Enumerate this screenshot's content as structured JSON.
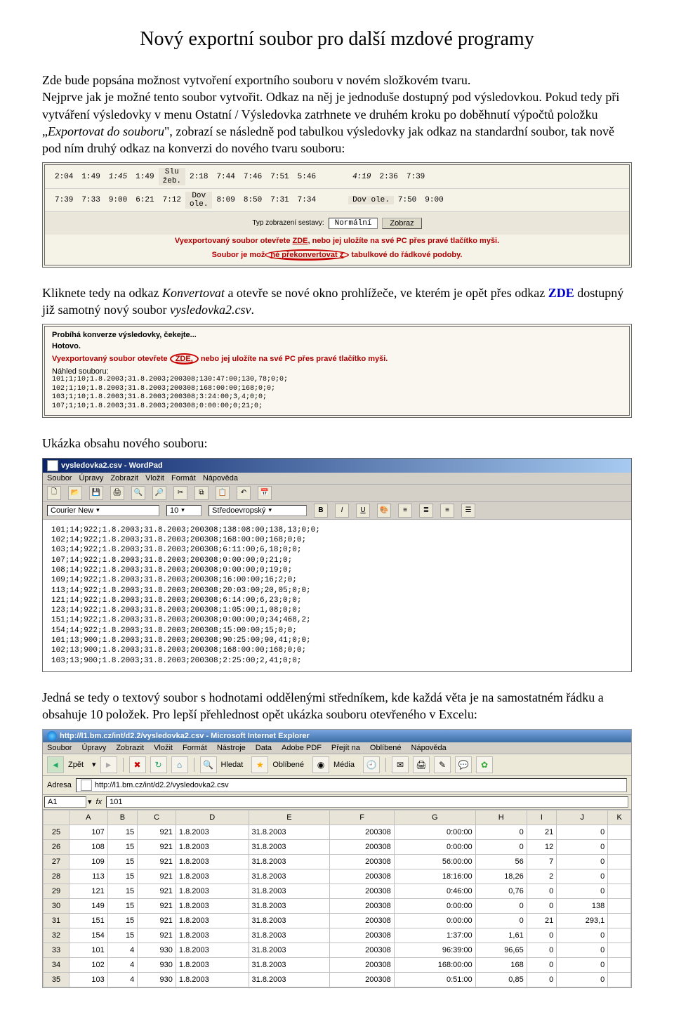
{
  "title": "Nový exportní soubor pro další mzdové programy",
  "intro": {
    "p1a": "Zde bude popsána možnost vytvoření exportního souboru v novém složkovém tvaru.",
    "p1b": "Nejprve jak je možné tento soubor vytvořit. Odkaz na něj je jednoduše dostupný pod výsledovkou. Pokud tedy při vytváření výsledovky v menu Ostatní / Výsledovka zatrhnete ve druhém kroku po doběhnutí výpočtů položku „",
    "p1c_italic": "Exportovat do souboru",
    "p1d": "\", zobrazí se následně pod tabulkou výsledovky jak odkaz na standardní soubor, tak nově pod ním druhý odkaz na konverzi do nového tvaru souboru:"
  },
  "panel1": {
    "row1": [
      "2:04",
      "1:49",
      "1:45",
      "1:49",
      "Slu\nžeb.",
      "2:18",
      "7:44",
      "7:46",
      "7:51",
      "5:46",
      "4:19",
      "2:36",
      "7:39"
    ],
    "row2": [
      "7:39",
      "7:33",
      "9:00",
      "6:21",
      "7:12",
      "Dov\nole.",
      "8:09",
      "8:50",
      "7:31",
      "7:34",
      "Dov\nole.",
      "7:50",
      "9:00"
    ],
    "display_label": "Typ zobrazení sestavy:",
    "display_value": "Normální",
    "display_btn": "Zobraz",
    "red1a": "Vyexportovaný soubor otevřete ",
    "red1_link": "ZDE",
    "red1b": ", nebo jej uložíte na své PC přes pravé tlačítko myši.",
    "red2a": "Soubor je mož",
    "red2_circle": "né překonvertovat z",
    "red2b": " tabulkové do řádkové podoby."
  },
  "mid": {
    "p2a": "Kliknete tedy na odkaz ",
    "p2b_italic": "Konvertovat",
    "p2c": "  a otevře se nové okno prohlížeče, ve kterém je opět přes odkaz ",
    "p2_zde": "ZDE",
    "p2d": " dostupný již samotný nový soubor ",
    "p2e_italic": "vysledovka2.csv",
    "p2f": "."
  },
  "panel2": {
    "line1": "Probíhá konverze výsledovky, čekejte...",
    "line2": "Hotovo.",
    "red_a": "Vyexportovaný soubor otevřete ",
    "red_link": "ZDE,",
    "red_b": " nebo jej uložíte na své PC přes pravé tlačítko myši.",
    "preview_label": "Náhled souboru:",
    "preview_lines": "101;1;10;1.8.2003;31.8.2003;200308;130:47:00;130,78;0;0;\n102;1;10;1.8.2003;31.8.2003;200308;168:00:00;168;0;0;\n103;1;10;1.8.2003;31.8.2003;200308;3:24:00;3,4;0;0;\n107;1;10;1.8.2003;31.8.2003;200308;0:00:00;0;21;0;"
  },
  "sample_label": "Ukázka obsahu nového souboru:",
  "wordpad": {
    "title": "vysledovka2.csv - WordPad",
    "menu": [
      "Soubor",
      "Úpravy",
      "Zobrazit",
      "Vložit",
      "Formát",
      "Nápověda"
    ],
    "font_name": "Courier New",
    "font_size": "10",
    "script": "Středoevropský",
    "body": "101;14;922;1.8.2003;31.8.2003;200308;138:08:00;138,13;0;0;\n102;14;922;1.8.2003;31.8.2003;200308;168:00:00;168;0;0;\n103;14;922;1.8.2003;31.8.2003;200308;6:11:00;6,18;0;0;\n107;14;922;1.8.2003;31.8.2003;200308;0:00:00;0;21;0;\n108;14;922;1.8.2003;31.8.2003;200308;0:00:00;0;19;0;\n109;14;922;1.8.2003;31.8.2003;200308;16:00:00;16;2;0;\n113;14;922;1.8.2003;31.8.2003;200308;20:03:00;20,05;0;0;\n121;14;922;1.8.2003;31.8.2003;200308;6:14:00;6,23;0;0;\n123;14;922;1.8.2003;31.8.2003;200308;1:05:00;1,08;0;0;\n151;14;922;1.8.2003;31.8.2003;200308;0:00:00;0;34;468,2;\n154;14;922;1.8.2003;31.8.2003;200308;15:00:00;15;0;0;\n101;13;900;1.8.2003;31.8.2003;200308;90:25:00;90,41;0;0;\n102;13;900;1.8.2003;31.8.2003;200308;168:00:00;168;0;0;\n103;13;900;1.8.2003;31.8.2003;200308;2:25:00;2,41;0;0;"
  },
  "para3a": "Jedná se tedy o textový soubor s hodnotami oddělenými středníkem, kde každá věta je na samostatném řádku a obsahuje 10 položek. Pro lepší přehlednost opět ukázka souboru otevřeného v Excelu:",
  "excel": {
    "title": "http://l1.bm.cz/int/d2.2/vysledovka2.csv - Microsoft Internet Explorer",
    "menu": [
      "Soubor",
      "Úpravy",
      "Zobrazit",
      "Vložit",
      "Formát",
      "Nástroje",
      "Data",
      "Adobe PDF",
      "Přejít na",
      "Oblíbené",
      "Nápověda"
    ],
    "back": "Zpět",
    "search": "Hledat",
    "fav": "Oblíbené",
    "media": "Média",
    "addr_label": "Adresa",
    "url": "http://l1.bm.cz/int/d2.2/vysledovka2.csv",
    "cell_name": "A1",
    "cell_value": "101",
    "cols": [
      "",
      "A",
      "B",
      "C",
      "D",
      "E",
      "F",
      "G",
      "H",
      "I",
      "J",
      "K"
    ],
    "rows": [
      {
        "n": "25",
        "c": [
          "107",
          "15",
          "921",
          "1.8.2003",
          "31.8.2003",
          "200308",
          "0:00:00",
          "0",
          "21",
          "0",
          ""
        ]
      },
      {
        "n": "26",
        "c": [
          "108",
          "15",
          "921",
          "1.8.2003",
          "31.8.2003",
          "200308",
          "0:00:00",
          "0",
          "12",
          "0",
          ""
        ]
      },
      {
        "n": "27",
        "c": [
          "109",
          "15",
          "921",
          "1.8.2003",
          "31.8.2003",
          "200308",
          "56:00:00",
          "56",
          "7",
          "0",
          ""
        ]
      },
      {
        "n": "28",
        "c": [
          "113",
          "15",
          "921",
          "1.8.2003",
          "31.8.2003",
          "200308",
          "18:16:00",
          "18,26",
          "2",
          "0",
          ""
        ]
      },
      {
        "n": "29",
        "c": [
          "121",
          "15",
          "921",
          "1.8.2003",
          "31.8.2003",
          "200308",
          "0:46:00",
          "0,76",
          "0",
          "0",
          ""
        ]
      },
      {
        "n": "30",
        "c": [
          "149",
          "15",
          "921",
          "1.8.2003",
          "31.8.2003",
          "200308",
          "0:00:00",
          "0",
          "0",
          "138",
          ""
        ]
      },
      {
        "n": "31",
        "c": [
          "151",
          "15",
          "921",
          "1.8.2003",
          "31.8.2003",
          "200308",
          "0:00:00",
          "0",
          "21",
          "293,1",
          ""
        ]
      },
      {
        "n": "32",
        "c": [
          "154",
          "15",
          "921",
          "1.8.2003",
          "31.8.2003",
          "200308",
          "1:37:00",
          "1,61",
          "0",
          "0",
          ""
        ]
      },
      {
        "n": "33",
        "c": [
          "101",
          "4",
          "930",
          "1.8.2003",
          "31.8.2003",
          "200308",
          "96:39:00",
          "96,65",
          "0",
          "0",
          ""
        ]
      },
      {
        "n": "34",
        "c": [
          "102",
          "4",
          "930",
          "1.8.2003",
          "31.8.2003",
          "200308",
          "168:00:00",
          "168",
          "0",
          "0",
          ""
        ]
      },
      {
        "n": "35",
        "c": [
          "103",
          "4",
          "930",
          "1.8.2003",
          "31.8.2003",
          "200308",
          "0:51:00",
          "0,85",
          "0",
          "0",
          ""
        ]
      }
    ]
  }
}
